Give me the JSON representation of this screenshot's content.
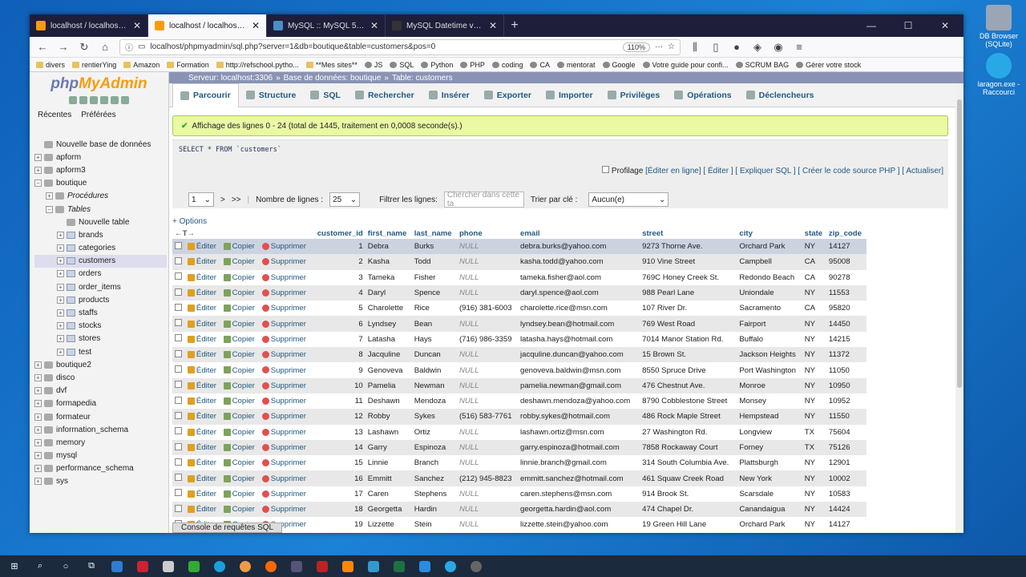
{
  "desktop": {
    "icons": [
      {
        "label": "DB Browser (SQLite)"
      },
      {
        "label": "laragon.exe - Raccourci"
      }
    ]
  },
  "browser": {
    "tabs": [
      {
        "title": "localhost / localhost / boutique",
        "active": false
      },
      {
        "title": "localhost / localhost / boutique",
        "active": true
      },
      {
        "title": "MySQL :: MySQL 5.7 Reference",
        "active": false
      },
      {
        "title": "MySQL Datetime vs Timestamp",
        "active": false
      }
    ],
    "url": "localhost/phpmyadmin/sql.php?server=1&db=boutique&table=customers&pos=0",
    "zoom": "110%",
    "bookmarks": [
      "divers",
      "rentierYing",
      "Amazon",
      "Formation",
      "http://refschool.pytho...",
      "**Mes sites**",
      "JS",
      "SQL",
      "Python",
      "PHP",
      "coding",
      "CA",
      "mentorat",
      "Google",
      "Votre guide pour confi...",
      "SCRUM BAG",
      "Gérer votre stock"
    ]
  },
  "sidebar": {
    "logo_a": "php",
    "logo_b": "MyAdmin",
    "tabs": [
      "Récentes",
      "Préférées"
    ],
    "tree": [
      {
        "label": "Nouvelle base de données",
        "level": 0,
        "type": "new"
      },
      {
        "label": "apform",
        "level": 0,
        "type": "db"
      },
      {
        "label": "apform3",
        "level": 0,
        "type": "db"
      },
      {
        "label": "boutique",
        "level": 0,
        "type": "db"
      },
      {
        "label": "Procédures",
        "level": 1,
        "type": "group"
      },
      {
        "label": "Tables",
        "level": 1,
        "type": "group"
      },
      {
        "label": "Nouvelle table",
        "level": 2,
        "type": "new"
      },
      {
        "label": "brands",
        "level": 2,
        "type": "tbl"
      },
      {
        "label": "categories",
        "level": 2,
        "type": "tbl"
      },
      {
        "label": "customers",
        "level": 2,
        "type": "tbl",
        "selected": true
      },
      {
        "label": "orders",
        "level": 2,
        "type": "tbl"
      },
      {
        "label": "order_items",
        "level": 2,
        "type": "tbl"
      },
      {
        "label": "products",
        "level": 2,
        "type": "tbl"
      },
      {
        "label": "staffs",
        "level": 2,
        "type": "tbl"
      },
      {
        "label": "stocks",
        "level": 2,
        "type": "tbl"
      },
      {
        "label": "stores",
        "level": 2,
        "type": "tbl"
      },
      {
        "label": "test",
        "level": 2,
        "type": "tbl"
      },
      {
        "label": "boutique2",
        "level": 0,
        "type": "db"
      },
      {
        "label": "disco",
        "level": 0,
        "type": "db"
      },
      {
        "label": "dvf",
        "level": 0,
        "type": "db"
      },
      {
        "label": "formapedia",
        "level": 0,
        "type": "db"
      },
      {
        "label": "formateur",
        "level": 0,
        "type": "db"
      },
      {
        "label": "information_schema",
        "level": 0,
        "type": "db"
      },
      {
        "label": "memory",
        "level": 0,
        "type": "db"
      },
      {
        "label": "mysql",
        "level": 0,
        "type": "db"
      },
      {
        "label": "performance_schema",
        "level": 0,
        "type": "db"
      },
      {
        "label": "sys",
        "level": 0,
        "type": "db"
      }
    ]
  },
  "breadcrumb": {
    "server": "Serveur: localhost:3306",
    "db": "Base de données: boutique",
    "table": "Table: customers"
  },
  "menu": [
    "Parcourir",
    "Structure",
    "SQL",
    "Rechercher",
    "Insérer",
    "Exporter",
    "Importer",
    "Privilèges",
    "Opérations",
    "Déclencheurs"
  ],
  "success": "Affichage des lignes 0 - 24 (total de 1445, traitement en 0,0008 seconde(s).)",
  "query": "SELECT * FROM `customers`",
  "profil": {
    "label": "Profilage",
    "links": "[Éditer en ligne] [ Éditer ] [ Expliquer SQL ] [ Créer le code source PHP ] [ Actualiser]"
  },
  "pager": {
    "page": "1",
    "next": ">",
    "last": ">>",
    "rows_label": "Nombre de lignes :",
    "rows": "25",
    "filter_label": "Filtrer les lignes:",
    "filter_placeholder": "Chercher dans cette ta",
    "sort_label": "Trier par clé :",
    "sort_value": "Aucun(e)"
  },
  "options_label": "+ Options",
  "actions": {
    "edit": "Éditer",
    "copy": "Copier",
    "delete": "Supprimer"
  },
  "columns": [
    "customer_id",
    "first_name",
    "last_name",
    "phone",
    "email",
    "street",
    "city",
    "state",
    "zip_code"
  ],
  "rows": [
    [
      "1",
      "Debra",
      "Burks",
      "NULL",
      "debra.burks@yahoo.com",
      "9273 Thorne Ave.",
      "Orchard Park",
      "NY",
      "14127"
    ],
    [
      "2",
      "Kasha",
      "Todd",
      "NULL",
      "kasha.todd@yahoo.com",
      "910 Vine Street",
      "Campbell",
      "CA",
      "95008"
    ],
    [
      "3",
      "Tameka",
      "Fisher",
      "NULL",
      "tameka.fisher@aol.com",
      "769C Honey Creek St.",
      "Redondo Beach",
      "CA",
      "90278"
    ],
    [
      "4",
      "Daryl",
      "Spence",
      "NULL",
      "daryl.spence@aol.com",
      "988 Pearl Lane",
      "Uniondale",
      "NY",
      "11553"
    ],
    [
      "5",
      "Charolette",
      "Rice",
      "(916) 381-6003",
      "charolette.rice@msn.com",
      "107 River Dr.",
      "Sacramento",
      "CA",
      "95820"
    ],
    [
      "6",
      "Lyndsey",
      "Bean",
      "NULL",
      "lyndsey.bean@hotmail.com",
      "769 West Road",
      "Fairport",
      "NY",
      "14450"
    ],
    [
      "7",
      "Latasha",
      "Hays",
      "(716) 986-3359",
      "latasha.hays@hotmail.com",
      "7014 Manor Station Rd.",
      "Buffalo",
      "NY",
      "14215"
    ],
    [
      "8",
      "Jacquline",
      "Duncan",
      "NULL",
      "jacquline.duncan@yahoo.com",
      "15 Brown St.",
      "Jackson Heights",
      "NY",
      "11372"
    ],
    [
      "9",
      "Genoveva",
      "Baldwin",
      "NULL",
      "genoveva.baldwin@msn.com",
      "8550 Spruce Drive",
      "Port Washington",
      "NY",
      "11050"
    ],
    [
      "10",
      "Pamelia",
      "Newman",
      "NULL",
      "pamelia.newman@gmail.com",
      "476 Chestnut Ave.",
      "Monroe",
      "NY",
      "10950"
    ],
    [
      "11",
      "Deshawn",
      "Mendoza",
      "NULL",
      "deshawn.mendoza@yahoo.com",
      "8790 Cobblestone Street",
      "Monsey",
      "NY",
      "10952"
    ],
    [
      "12",
      "Robby",
      "Sykes",
      "(516) 583-7761",
      "robby.sykes@hotmail.com",
      "486 Rock Maple Street",
      "Hempstead",
      "NY",
      "11550"
    ],
    [
      "13",
      "Lashawn",
      "Ortiz",
      "NULL",
      "lashawn.ortiz@msn.com",
      "27 Washington Rd.",
      "Longview",
      "TX",
      "75604"
    ],
    [
      "14",
      "Garry",
      "Espinoza",
      "NULL",
      "garry.espinoza@hotmail.com",
      "7858 Rockaway Court",
      "Forney",
      "TX",
      "75126"
    ],
    [
      "15",
      "Linnie",
      "Branch",
      "NULL",
      "linnie.branch@gmail.com",
      "314 South Columbia Ave.",
      "Plattsburgh",
      "NY",
      "12901"
    ],
    [
      "16",
      "Emmitt",
      "Sanchez",
      "(212) 945-8823",
      "emmitt.sanchez@hotmail.com",
      "461 Squaw Creek Road",
      "New York",
      "NY",
      "10002"
    ],
    [
      "17",
      "Caren",
      "Stephens",
      "NULL",
      "caren.stephens@msn.com",
      "914 Brook St.",
      "Scarsdale",
      "NY",
      "10583"
    ],
    [
      "18",
      "Georgetta",
      "Hardin",
      "NULL",
      "georgetta.hardin@aol.com",
      "474 Chapel Dr.",
      "Canandaigua",
      "NY",
      "14424"
    ],
    [
      "19",
      "Lizzette",
      "Stein",
      "NULL",
      "lizzette.stein@yahoo.com",
      "19 Green Hill Lane",
      "Orchard Park",
      "NY",
      "14127"
    ]
  ],
  "console_label": "Console de requêtes SQL"
}
